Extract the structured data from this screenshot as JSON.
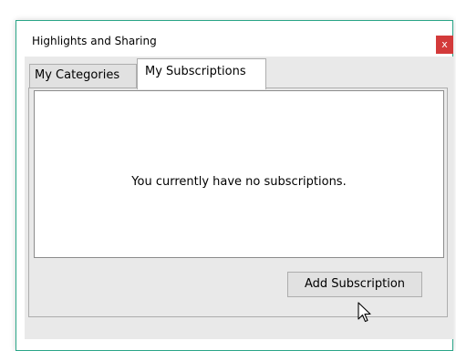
{
  "window": {
    "title": "Highlights and Sharing",
    "close_label": "x"
  },
  "tabs": [
    {
      "label": "My Categories",
      "active": false
    },
    {
      "label": "My Subscriptions",
      "active": true
    }
  ],
  "panel": {
    "empty_message": "You currently have no subscriptions."
  },
  "actions": {
    "add_subscription_label": "Add Subscription"
  },
  "colors": {
    "accent_border": "#2aa588",
    "close_button": "#d33a3a"
  },
  "icons": {
    "close": "close-icon",
    "cursor": "mouse-pointer-icon"
  }
}
